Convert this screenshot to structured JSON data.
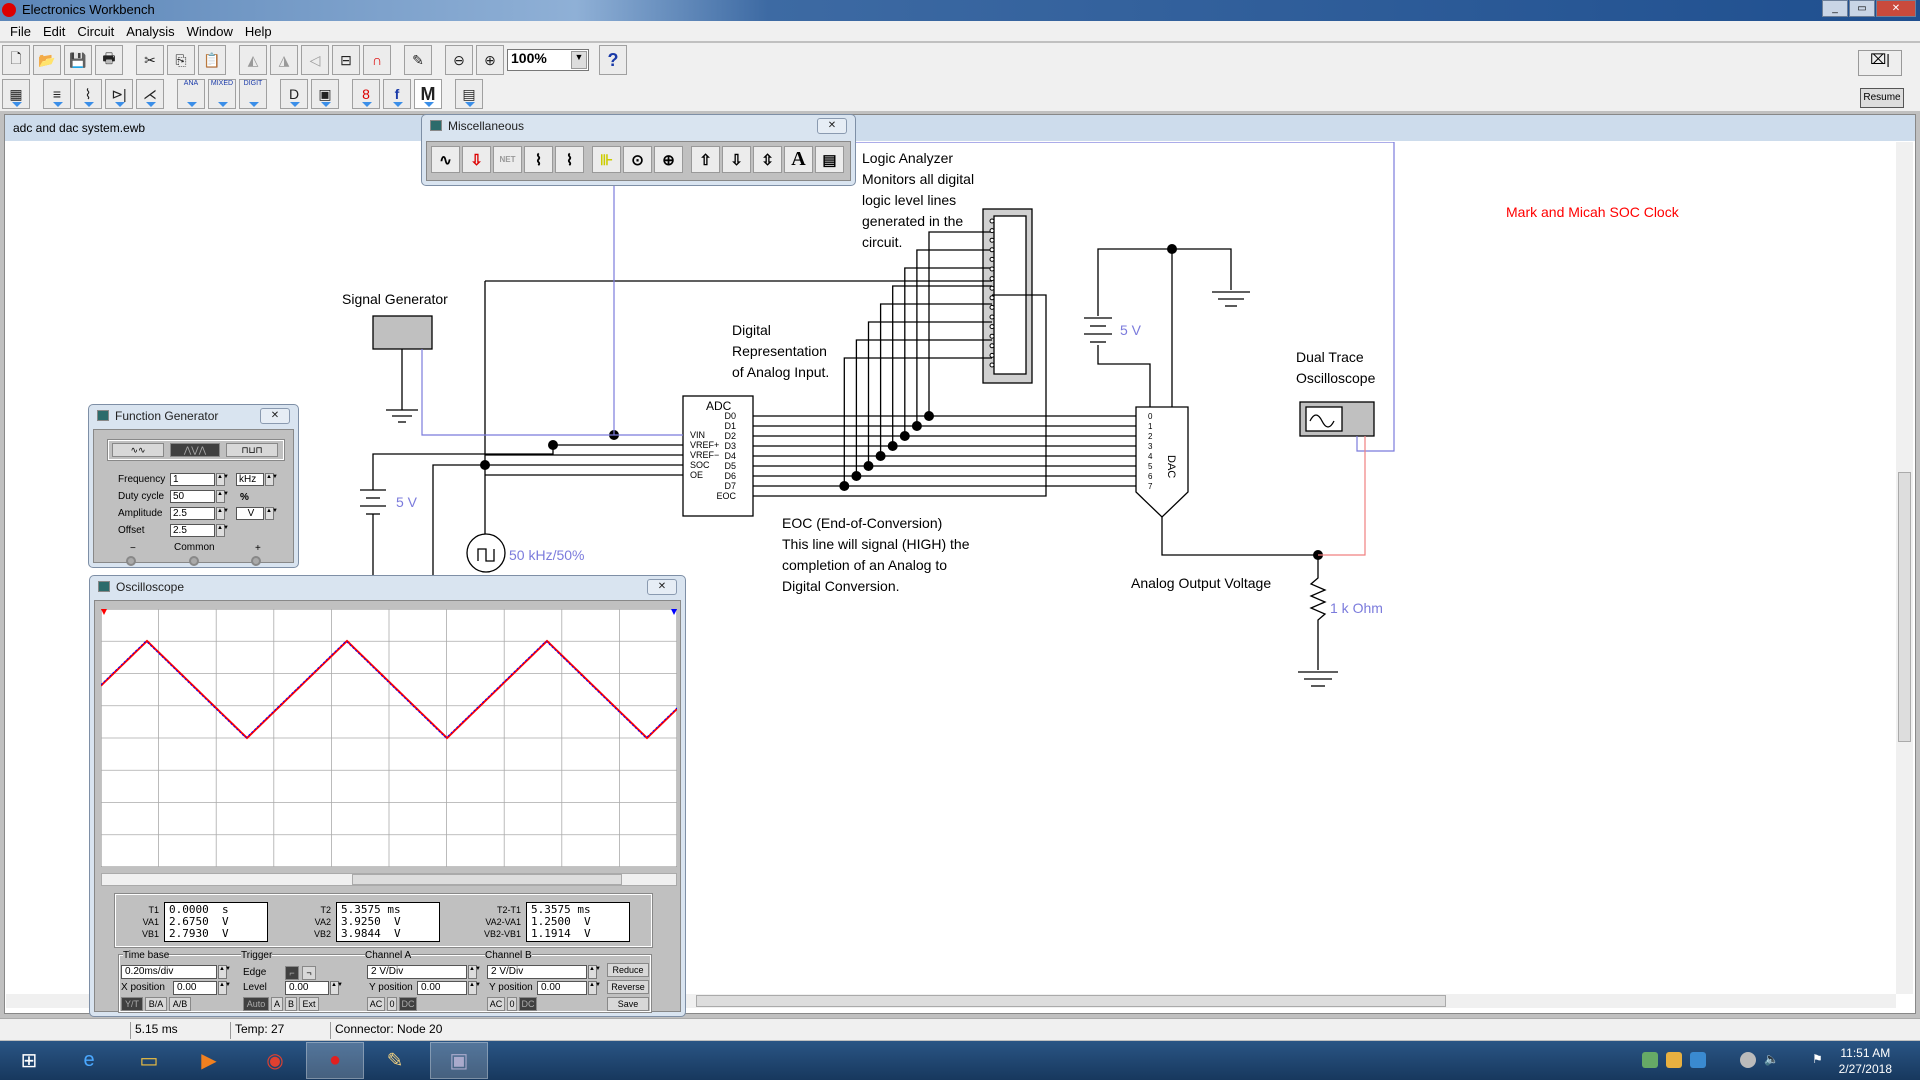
{
  "app": {
    "title": "Electronics Workbench"
  },
  "menu": [
    "File",
    "Edit",
    "Circuit",
    "Analysis",
    "Window",
    "Help"
  ],
  "toolbar": {
    "zoom": "100%",
    "help": "?"
  },
  "toolbar2": {
    "ana": "ANA",
    "mixed": "MIXED",
    "digit": "DIGIT",
    "m": "M",
    "f": "f"
  },
  "resume": "Resume",
  "document": {
    "title": "adc and dac system.ewb"
  },
  "misc_palette": {
    "title": "Miscellaneous",
    "net": "NET",
    "text_tool": "A"
  },
  "circuit": {
    "logic_analyzer_label": [
      "Logic Analyzer",
      "Monitors all digital",
      "logic level lines",
      "generated in the",
      "circuit."
    ],
    "signal_generator_label": "Signal Generator",
    "digital_label": [
      "Digital",
      "Representation",
      "of Analog Input."
    ],
    "adc": {
      "title": "ADC",
      "inputs": [
        "VIN",
        "VREF+",
        "VREF−",
        "SOC",
        "OE"
      ],
      "outputs": [
        "D0",
        "D1",
        "D2",
        "D3",
        "D4",
        "D5",
        "D6",
        "D7",
        "EOC"
      ]
    },
    "dac": {
      "title": "DAC",
      "pins": [
        "0",
        "1",
        "2",
        "3",
        "4",
        "5",
        "6",
        "7"
      ]
    },
    "battery_right": "5 V",
    "battery_left": "5 V",
    "clock_label": "50 kHz/50%",
    "eoc_label": [
      "EOC (End-of-Conversion)",
      "This line will signal (HIGH) the",
      "completion of an Analog to",
      "Digital Conversion."
    ],
    "scope_label": [
      "Dual Trace",
      "Oscilloscope"
    ],
    "soc_clock_label": "Mark and Micah SOC Clock",
    "analog_output_label": "Analog Output Voltage",
    "resistor_label": "1 k Ohm",
    "wire_color": "#7b7bdc",
    "accent_red": "#ff0000"
  },
  "function_generator": {
    "title": "Function Generator",
    "waveform_selected": "triangle",
    "frequency_label": "Frequency",
    "frequency": "1",
    "frequency_unit": "kHz",
    "duty_label": "Duty cycle",
    "duty": "50",
    "duty_unit": "%",
    "amplitude_label": "Amplitude",
    "amplitude": "2.5",
    "amplitude_unit": "V",
    "offset_label": "Offset",
    "offset": "2.5",
    "minus": "−",
    "common": "Common",
    "plus": "+"
  },
  "oscilloscope": {
    "title": "Oscilloscope",
    "readouts": {
      "t1_label": "T1",
      "t1": "0.0000  s",
      "va1_label": "VA1",
      "va1": "2.6750  V",
      "vb1_label": "VB1",
      "vb1": "2.7930  V",
      "t2_label": "T2",
      "t2": "5.3575 ms",
      "va2_label": "VA2",
      "va2": "3.9250  V",
      "vb2_label": "VB2",
      "vb2": "3.9844  V",
      "dt_label": "T2-T1",
      "dt": "5.3575 ms",
      "dva_label": "VA2-VA1",
      "dva": "1.2500  V",
      "dvb_label": "VB2-VB1",
      "dvb": "1.1914  V"
    },
    "timebase": {
      "label": "Time base",
      "value": "0.20ms/div",
      "xpos_label": "X position",
      "xpos": "0.00",
      "modes": [
        "Y/T",
        "B/A",
        "A/B"
      ]
    },
    "trigger": {
      "label": "Trigger",
      "edge_label": "Edge",
      "level_label": "Level",
      "level": "0.00",
      "sources": [
        "Auto",
        "A",
        "B",
        "Ext"
      ]
    },
    "channel_a": {
      "label": "Channel A",
      "value": "2 V/Div",
      "ypos_label": "Y position",
      "ypos": "0.00",
      "coupling": [
        "AC",
        "0",
        "DC"
      ]
    },
    "channel_b": {
      "label": "Channel B",
      "value": "2 V/Div",
      "ypos_label": "Y position",
      "ypos": "0.00",
      "coupling": [
        "AC",
        "0",
        "DC"
      ]
    },
    "buttons": {
      "reduce": "Reduce",
      "reverse": "Reverse",
      "save": "Save"
    },
    "trace_a_color": "#ff0000",
    "trace_b_color": "#0000ff"
  },
  "status": {
    "time": "5.15 ms",
    "temp": "Temp:  27",
    "connector": "Connector: Node 20"
  },
  "taskbar": {
    "time": "11:51 AM",
    "date": "2/27/2018"
  }
}
